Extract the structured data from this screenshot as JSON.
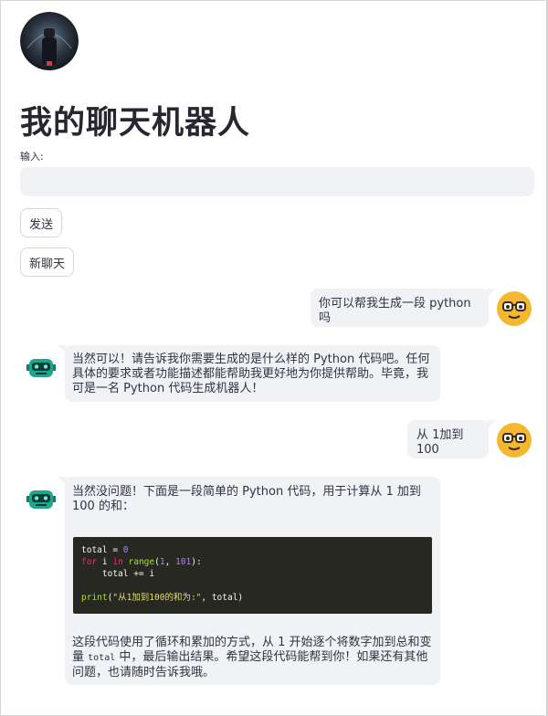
{
  "app": {
    "title": "我的聊天机器人",
    "input_label": "输入:",
    "input_value": "",
    "input_placeholder": "",
    "send_label": "发送",
    "new_chat_label": "新聊天"
  },
  "colors": {
    "bubble_bg": "#f0f2f6",
    "code_bg": "#272822",
    "user_avatar": "#f5b730",
    "bot_avatar": "#1fa68c"
  },
  "icons": {
    "logo": "robot-logo-icon",
    "user_avatar": "nerd-face-avatar-icon",
    "bot_avatar": "robot-avatar-icon"
  },
  "messages": [
    {
      "role": "user",
      "text": "你可以帮我生成一段 python 吗"
    },
    {
      "role": "bot",
      "text": "当然可以！请告诉我你需要生成的是什么样的 Python 代码吧。任何具体的要求或者功能描述都能帮助我更好地为你提供帮助。毕竟，我可是一名 Python 代码生成机器人！"
    },
    {
      "role": "user",
      "text": "从 1加到100"
    },
    {
      "role": "bot",
      "intro": "当然没问题！下面是一段简单的 Python 代码，用于计算从 1 加到 100 的和：",
      "code": {
        "line1_var": "total",
        "line1_op": " = ",
        "line1_val": "0",
        "line2_for": "for",
        "line2_i": " i ",
        "line2_in": "in",
        "line2_range": " range",
        "line2_open": "(",
        "line2_a": "1",
        "line2_comma": ", ",
        "line2_b": "101",
        "line2_close": "):",
        "line3": "    total += i",
        "line5_fn": "print",
        "line5_open": "(",
        "line5_str": "\"从1加到100的和为:\"",
        "line5_rest": ", total)"
      },
      "outro_part1": "这段代码使用了循环和累加的方式，从 1 开始逐个将数字加到总和变量 ",
      "outro_code": "total",
      "outro_part2": " 中，最后输出结果。希望这段代码能帮到你！如果还有其他问题，也请随时告诉我哦。"
    }
  ]
}
